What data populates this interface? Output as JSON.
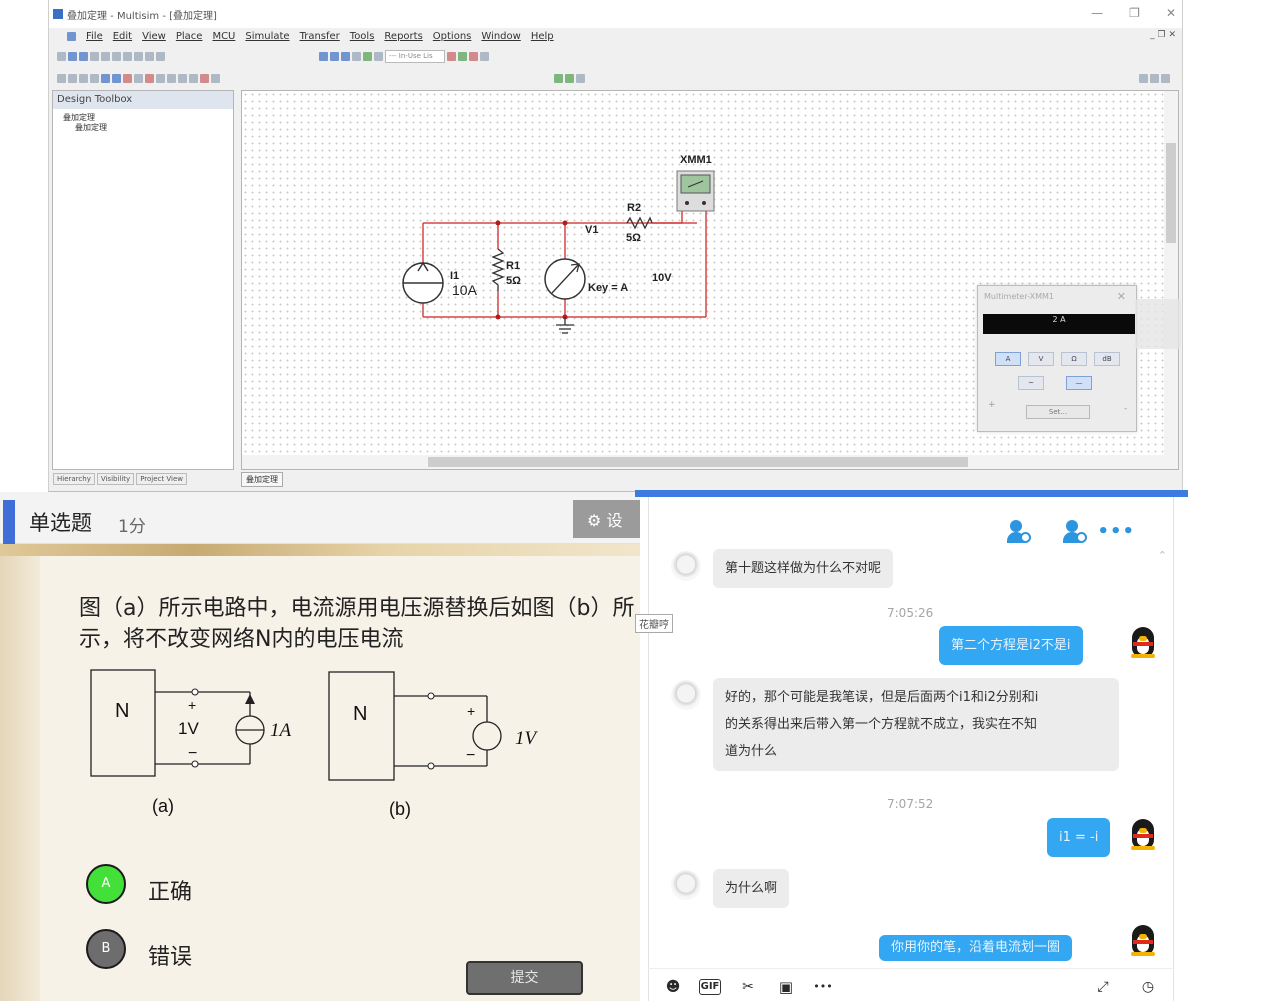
{
  "multisim": {
    "window_title": "叠加定理 - Multisim - [叠加定理]",
    "menu": [
      "File",
      "Edit",
      "View",
      "Place",
      "MCU",
      "Simulate",
      "Transfer",
      "Tools",
      "Reports",
      "Options",
      "Window",
      "Help"
    ],
    "toolbar_dropdown": "--- In-Use Lis",
    "toolbox": {
      "title": "Design Toolbox",
      "tree": [
        "叠加定理",
        "叠加定理"
      ],
      "tabs": [
        "Hierarchy",
        "Visibility",
        "Project View"
      ]
    },
    "document_tab": "叠加定理",
    "circuit": {
      "instrument_label": "XMM1",
      "r2_label": "R2",
      "r2_value": "5Ω",
      "v1_label": "V1",
      "i1_label": "I1",
      "i1_value": "10A",
      "r1_label": "R1",
      "r1_value": "5Ω",
      "key_label": "Key = A",
      "v_value": "10V"
    },
    "multimeter": {
      "title": "Multimeter-XMM1",
      "reading": "2 A",
      "modes": [
        "A",
        "V",
        "Ω",
        "dB"
      ],
      "ac_label": "~",
      "dc_label": "—",
      "set_label": "Set...",
      "plus": "+",
      "minus": "-"
    }
  },
  "quiz": {
    "type": "单选题",
    "score": "1分",
    "settings_label": "设",
    "question": "图（a）所示电路中，电流源用电压源替换后如图（b）所示，将不改变网络N内的电压电流",
    "figure_a": {
      "box_label": "N",
      "plus": "+",
      "voltage": "1V",
      "minus": "−",
      "current": "1A",
      "caption": "(a)"
    },
    "figure_b": {
      "box_label": "N",
      "plus": "+",
      "minus": "−",
      "voltage": "1V",
      "caption": "(b)"
    },
    "options": [
      {
        "letter": "A",
        "text": "正确",
        "color": "#44e03a"
      },
      {
        "letter": "B",
        "text": "错误",
        "color": "#6d6d6d"
      }
    ],
    "submit": "提交"
  },
  "chat": {
    "side_tag": "花瓣哼",
    "more": "•••",
    "messages": [
      {
        "dir": "in",
        "text": "第十题这样做为什么不对呢"
      },
      {
        "time": "7:05:26"
      },
      {
        "dir": "out",
        "text": "第二个方程是i2不是i"
      },
      {
        "dir": "in",
        "text_lines": [
          "好的，那个可能是我笔误，但是后面两个i1和i2分别和i",
          "的关系得出来后带入第一个方程就不成立，我实在不知",
          "道为什么"
        ]
      },
      {
        "time": "7:07:52"
      },
      {
        "dir": "out",
        "text": "i1 = -i"
      },
      {
        "dir": "in",
        "text": "为什么啊"
      },
      {
        "dir": "out",
        "text": "你用你的笔，沿着电流划一圈"
      }
    ],
    "toolbar_icons": [
      "emoji-icon",
      "gif-icon",
      "scissors-icon",
      "image-icon",
      "more-icon",
      "expand-icon",
      "history-icon"
    ],
    "toolbar_labels": {
      "gif": "GIF",
      "more": "•••"
    }
  }
}
